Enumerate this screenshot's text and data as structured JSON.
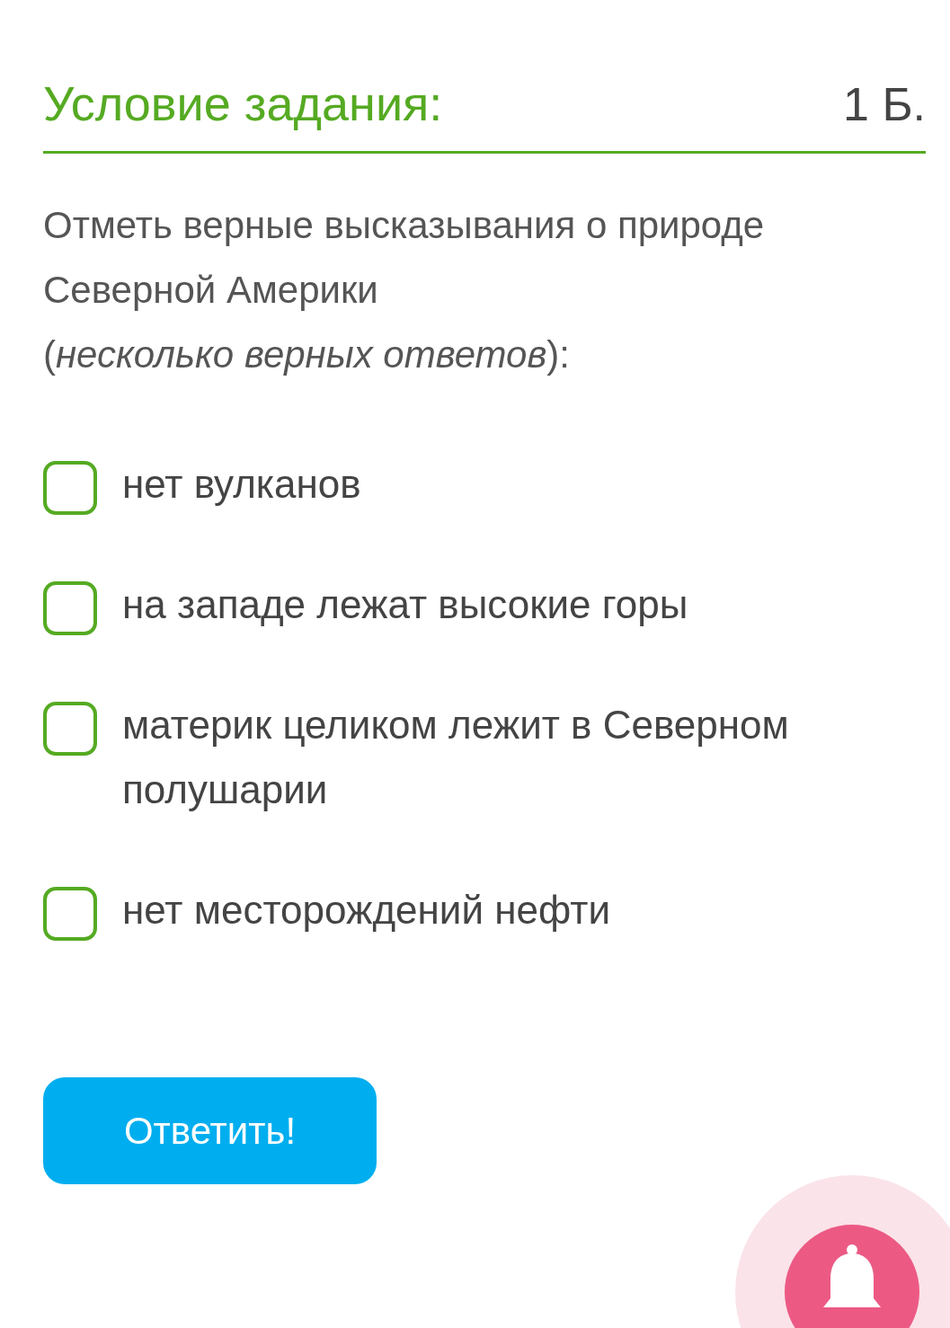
{
  "header": {
    "title": "Условие задания:",
    "points": "1 Б."
  },
  "question": "Отметь верные высказывания о природе Северной Америки\n(*несколько верных ответов*):",
  "options": [
    {
      "label": "нет вулканов",
      "checked": false
    },
    {
      "label": "на западе лежат высокие горы",
      "checked": false
    },
    {
      "label": "материк целиком лежит в Северном полушарии",
      "checked": false
    },
    {
      "label": "нет месторождений нефти",
      "checked": false
    }
  ],
  "submit": "Ответить!"
}
